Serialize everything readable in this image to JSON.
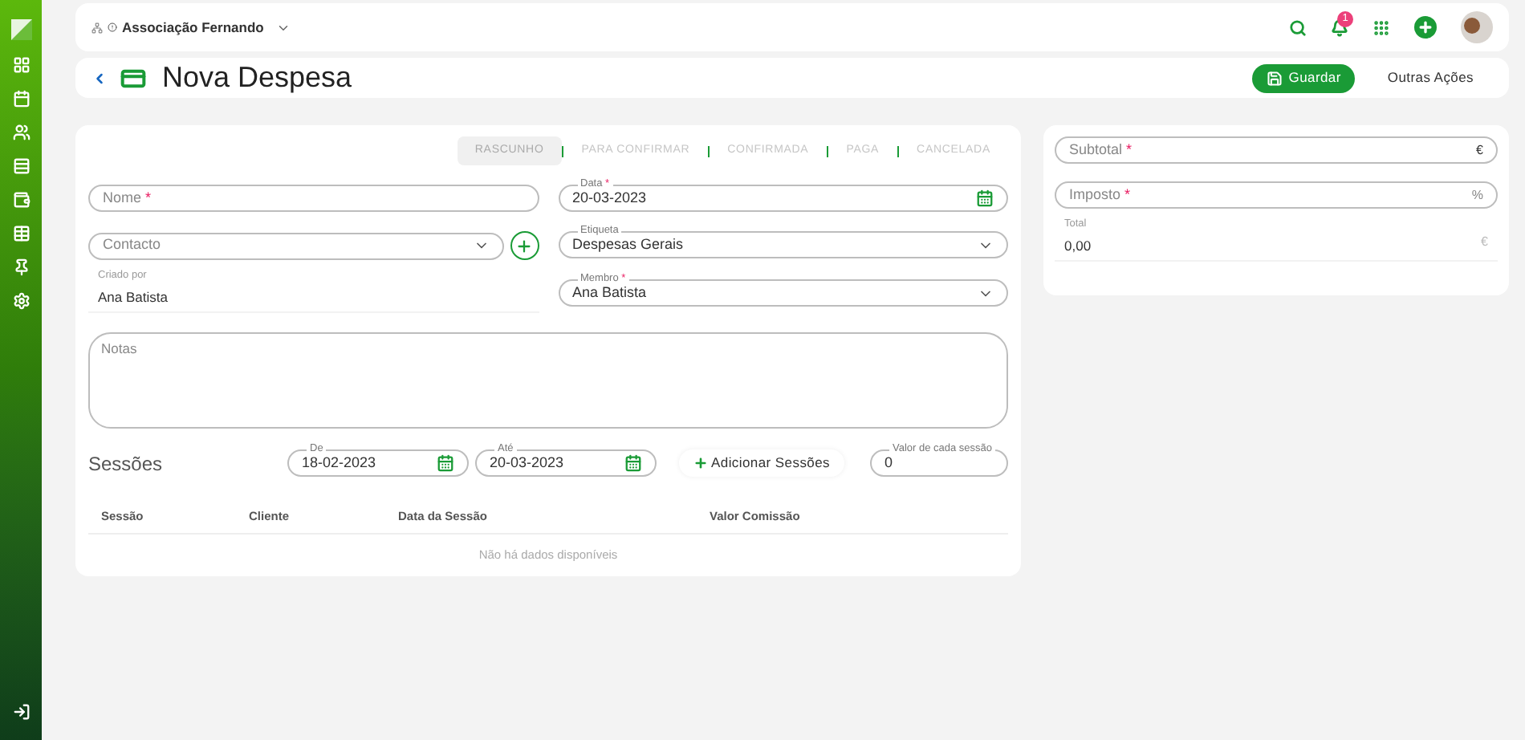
{
  "topbar": {
    "organization": "Associação Fernando",
    "notifications": "1"
  },
  "header": {
    "title": "Nova Despesa",
    "save": "Guardar",
    "more": "Outras Ações"
  },
  "statuses": [
    {
      "label": "RASCUNHO",
      "selected": true
    },
    {
      "label": "PARA CONFIRMAR",
      "selected": false
    },
    {
      "label": "CONFIRMADA",
      "selected": false
    },
    {
      "label": "PAGA",
      "selected": false
    },
    {
      "label": "CANCELADA",
      "selected": false
    }
  ],
  "form": {
    "name": {
      "placeholder": "Nome",
      "required_mark": "*"
    },
    "date": {
      "label": "Data",
      "required_mark": "*",
      "value": "20-03-2023"
    },
    "contact": {
      "placeholder": "Contacto"
    },
    "tag": {
      "label": "Etiqueta",
      "value": "Despesas Gerais"
    },
    "created_by": {
      "label": "Criado por",
      "value": "Ana Batista"
    },
    "member": {
      "label": "Membro",
      "required_mark": "*",
      "value": "Ana Batista"
    },
    "notes": {
      "placeholder": "Notas"
    }
  },
  "sessions": {
    "title": "Sessões",
    "from": {
      "label": "De",
      "value": "18-02-2023"
    },
    "to": {
      "label": "Até",
      "value": "20-03-2023"
    },
    "add": "Adicionar Sessões",
    "each": {
      "label": "Valor de cada sessão",
      "value": "0"
    },
    "columns": [
      "Sessão",
      "Cliente",
      "Data da Sessão",
      "Valor Comissão"
    ],
    "empty": "Não há dados disponíveis"
  },
  "totals": {
    "subtotal": {
      "placeholder": "Subtotal",
      "required_mark": "*",
      "unit": "€"
    },
    "tax": {
      "placeholder": "Imposto",
      "required_mark": "*",
      "unit": "%"
    },
    "total": {
      "label": "Total",
      "value": "0,00",
      "unit": "€"
    }
  }
}
